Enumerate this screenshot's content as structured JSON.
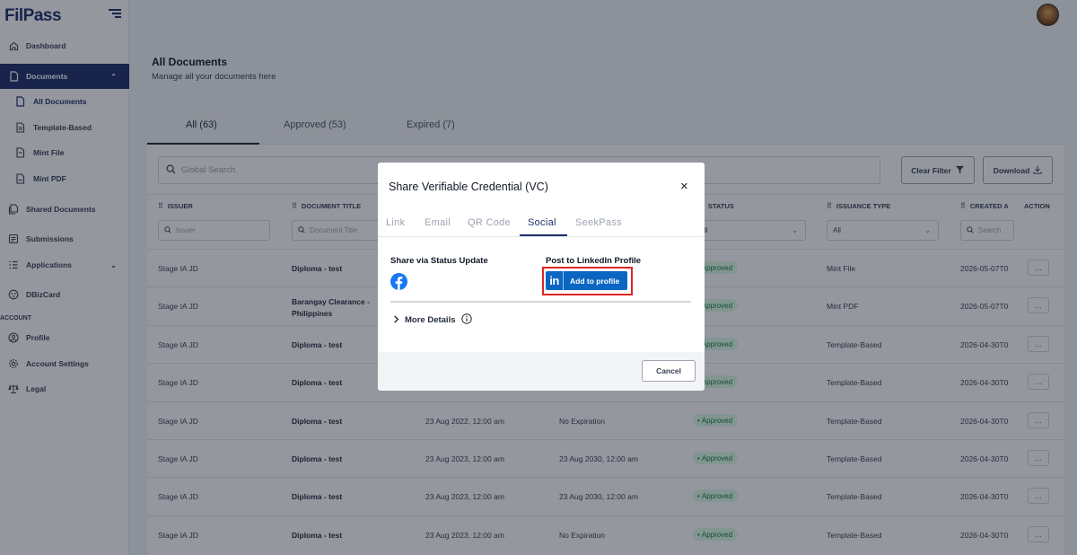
{
  "brand": {
    "logo_text": "FilPass"
  },
  "sidebar": {
    "items": [
      {
        "label": "Dashboard",
        "icon": "home-icon"
      },
      {
        "label": "Documents",
        "icon": "document-icon"
      },
      {
        "label": "All Documents",
        "icon": "document-icon"
      },
      {
        "label": "Template-Based",
        "icon": "template-icon"
      },
      {
        "label": "Mint File",
        "icon": "file-icon"
      },
      {
        "label": "Mint PDF",
        "icon": "pdf-icon"
      },
      {
        "label": "Shared Documents",
        "icon": "shared-icon"
      },
      {
        "label": "Submissions",
        "icon": "submission-icon"
      },
      {
        "label": "Applications",
        "icon": "applications-icon"
      },
      {
        "label": "DBizCard",
        "icon": "card-icon"
      }
    ],
    "account_label": "ACCOUNT",
    "account_items": [
      {
        "label": "Profile",
        "icon": "user-icon"
      },
      {
        "label": "Account Settings",
        "icon": "gear-icon"
      },
      {
        "label": "Legal",
        "icon": "scale-icon"
      }
    ]
  },
  "page": {
    "title": "All Documents",
    "subtitle": "Manage all your documents here",
    "tabs": [
      {
        "label": "All (63)"
      },
      {
        "label": "Approved (53)"
      },
      {
        "label": "Expired (7)"
      }
    ]
  },
  "toolbar": {
    "search_placeholder": "Global Search",
    "clear_filter": "Clear Filter",
    "download": "Download"
  },
  "table": {
    "columns": [
      "ISSUER",
      "DOCUMENT TITLE",
      "STATUS",
      "ISSUANCE TYPE",
      "CREATED A",
      "ACTION"
    ],
    "filters": {
      "issuer": "Issuer",
      "document_title": "Document Title",
      "status": "ll",
      "issuance_type": "All",
      "created": "Search"
    },
    "rows": [
      {
        "issuer": "Stage IA JD",
        "title": "Diploma - test",
        "issued": "",
        "expiry": "",
        "status": "Approved",
        "type": "Mint File",
        "created": "2026-05-07T0"
      },
      {
        "issuer": "Stage IA JD",
        "title": "Barangay Clearance - Philippines",
        "issued": "",
        "expiry": "",
        "status": "Approved",
        "type": "Mint PDF",
        "created": "2026-05-07T0"
      },
      {
        "issuer": "Stage IA JD",
        "title": "Diploma - test",
        "issued": "",
        "expiry": "",
        "status": "Approved",
        "type": "Template-Based",
        "created": "2026-04-30T0"
      },
      {
        "issuer": "Stage IA JD",
        "title": "Diploma - test",
        "issued": "",
        "expiry": "",
        "status": "Approved",
        "type": "Template-Based",
        "created": "2026-04-30T0"
      },
      {
        "issuer": "Stage IA JD",
        "title": "Diploma - test",
        "issued": "23 Aug 2022, 12:00 am",
        "expiry": "No Expiration",
        "status": "Approved",
        "type": "Template-Based",
        "created": "2026-04-30T0"
      },
      {
        "issuer": "Stage IA JD",
        "title": "Diploma - test",
        "issued": "23 Aug 2023, 12:00 am",
        "expiry": "23 Aug 2030, 12:00 am",
        "status": "Approved",
        "type": "Template-Based",
        "created": "2026-04-30T0"
      },
      {
        "issuer": "Stage IA JD",
        "title": "Diploma - test",
        "issued": "23 Aug 2023, 12:00 am",
        "expiry": "23 Aug 2030, 12:00 am",
        "status": "Approved",
        "type": "Template-Based",
        "created": "2026-04-30T0"
      },
      {
        "issuer": "Stage IA JD",
        "title": "Diploma - test",
        "issued": "23 Aug 2023, 12:00 am",
        "expiry": "No Expiration",
        "status": "Approved",
        "type": "Template-Based",
        "created": "2026-04-30T0"
      }
    ],
    "action_label": "..."
  },
  "modal": {
    "title": "Share Verifiable Credential (VC)",
    "close": "×",
    "tabs": [
      "Link",
      "Email",
      "QR Code",
      "Social",
      "SeekPass"
    ],
    "active_tab": "Social",
    "status_update_label": "Share via Status Update",
    "linkedin_label": "Post to LinkedIn Profile",
    "linkedin_button": "Add to profile",
    "linkedin_logo": "in",
    "more_details": "More Details",
    "cancel": "Cancel"
  },
  "colors": {
    "brand": "#1e2f6b",
    "linkedin": "#0a66c2",
    "facebook": "#1877f2",
    "highlight": "#dc2626",
    "badge_bg": "#dcfce7",
    "badge_text": "#15803d"
  }
}
